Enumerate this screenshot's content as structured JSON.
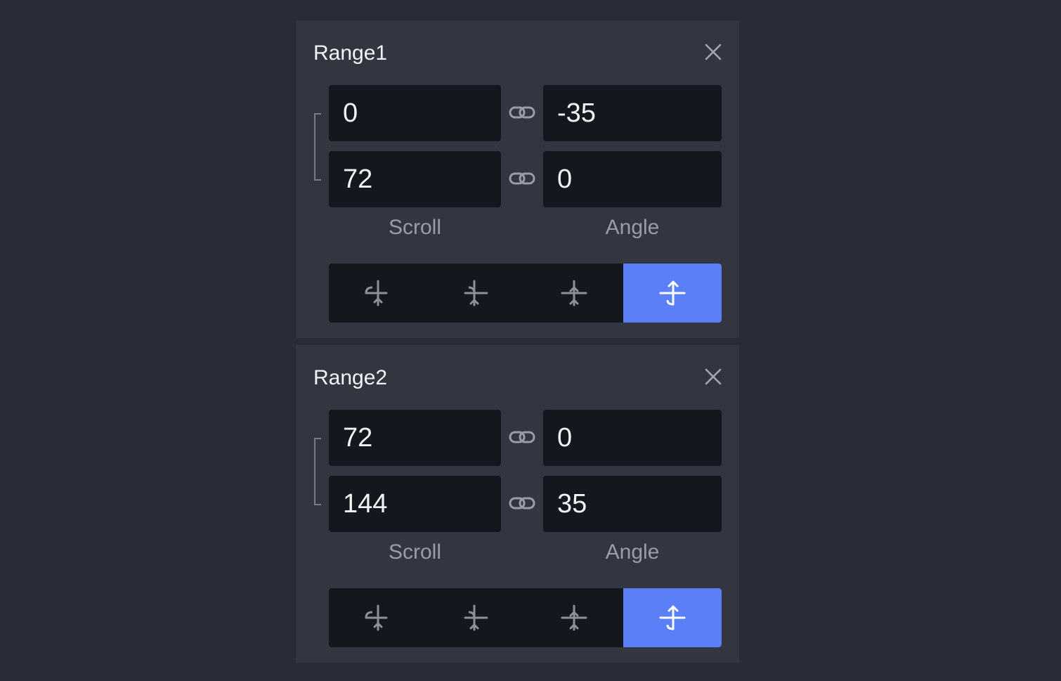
{
  "colors": {
    "background": "#292b36",
    "panel": "#333541",
    "field": "#15171e",
    "accent": "#5b7ff7"
  },
  "ranges": [
    {
      "title": "Range1",
      "close_icon": "close-icon",
      "scroll": [
        "0",
        "72"
      ],
      "angle": [
        "-35",
        "0"
      ],
      "scroll_label": "Scroll",
      "angle_label": "Angle",
      "modes": [
        "mode-1-icon",
        "mode-2-icon",
        "mode-3-icon",
        "mode-4-icon"
      ],
      "active_mode": 4
    },
    {
      "title": "Range2",
      "close_icon": "close-icon",
      "scroll": [
        "72",
        "144"
      ],
      "angle": [
        "0",
        "35"
      ],
      "scroll_label": "Scroll",
      "angle_label": "Angle",
      "modes": [
        "mode-1-icon",
        "mode-2-icon",
        "mode-3-icon",
        "mode-4-icon"
      ],
      "active_mode": 4
    }
  ]
}
